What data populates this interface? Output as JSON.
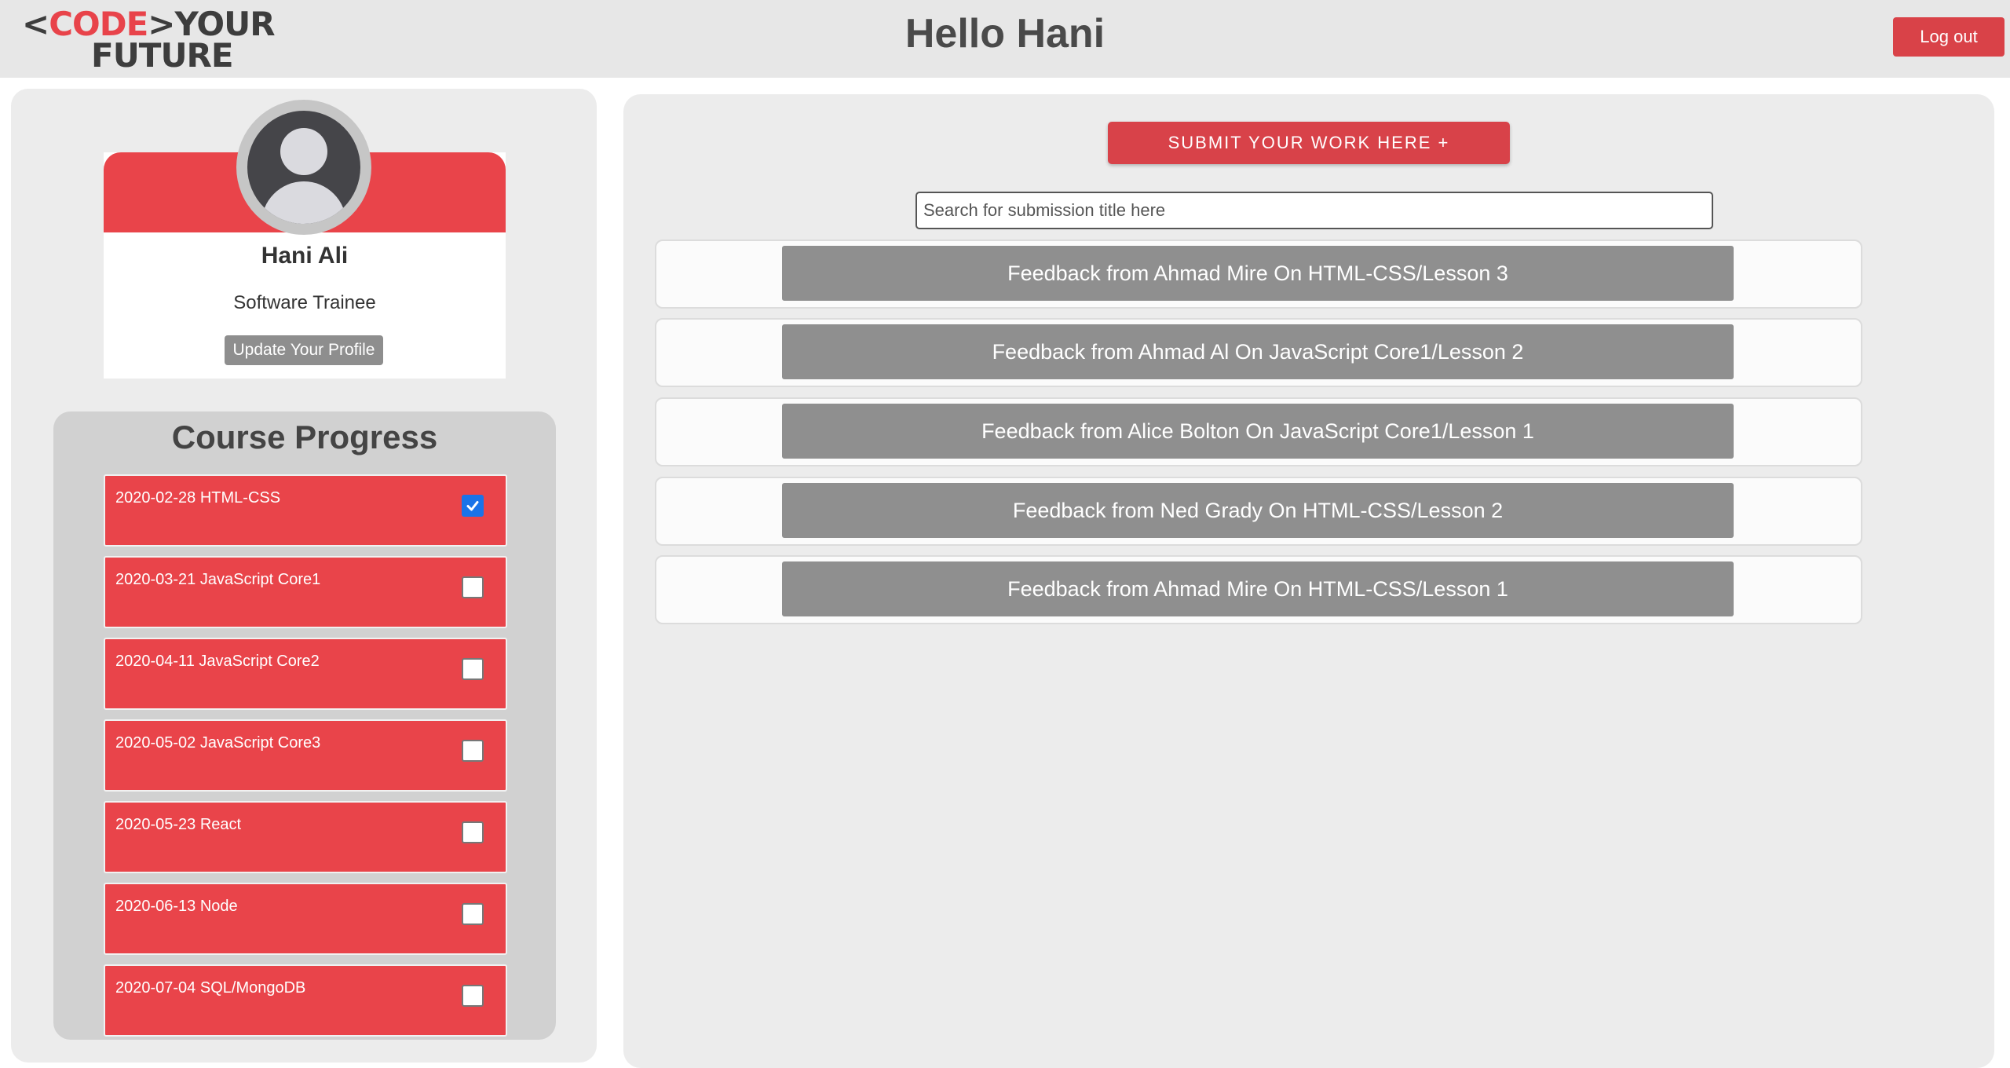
{
  "header": {
    "logo": {
      "open_bracket": "<",
      "code": "CODE",
      "close_bracket": ">",
      "your": "YOUR",
      "future": "FUTURE"
    },
    "greeting": "Hello Hani",
    "logout_label": "Log out"
  },
  "profile": {
    "name": "Hani Ali",
    "role": "Software Trainee",
    "update_label": "Update Your Profile"
  },
  "progress": {
    "title": "Course Progress",
    "items": [
      {
        "label": "2020-02-28 HTML-CSS",
        "checked": true
      },
      {
        "label": "2020-03-21 JavaScript Core1",
        "checked": false
      },
      {
        "label": "2020-04-11 JavaScript Core2",
        "checked": false
      },
      {
        "label": "2020-05-02 JavaScript Core3",
        "checked": false
      },
      {
        "label": "2020-05-23 React",
        "checked": false
      },
      {
        "label": "2020-06-13 Node",
        "checked": false
      },
      {
        "label": "2020-07-04 SQL/MongoDB",
        "checked": false
      }
    ]
  },
  "submissions": {
    "submit_label": "SUBMIT YOUR WORK HERE +",
    "search_placeholder": "Search for submission title here",
    "feedback": [
      "Feedback from Ahmad Mire On HTML-CSS/Lesson 3",
      "Feedback from Ahmad Al On JavaScript Core1/Lesson 2",
      "Feedback from Alice Bolton On JavaScript Core1/Lesson 1",
      "Feedback from Ned Grady On HTML-CSS/Lesson 2",
      "Feedback from Ahmad Mire On HTML-CSS/Lesson 1"
    ]
  },
  "colors": {
    "brand_red": "#e9444a",
    "button_gray": "#8f8f8f",
    "panel_gray": "#ececec"
  }
}
